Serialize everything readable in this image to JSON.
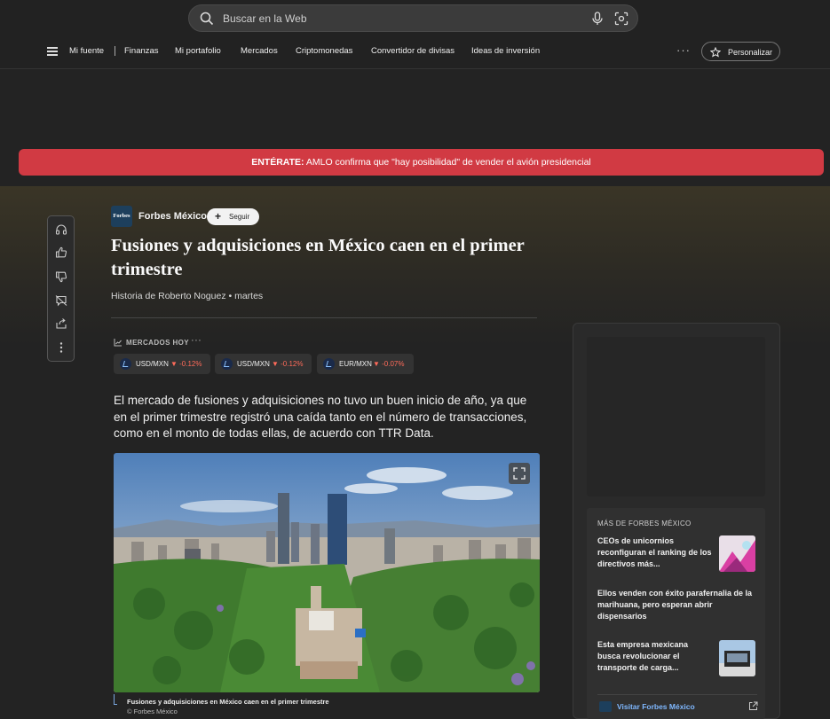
{
  "search": {
    "placeholder": "Buscar en la Web"
  },
  "nav": {
    "items": [
      "Mi fuente",
      "Finanzas",
      "Mi portafolio",
      "Mercados",
      "Criptomonedas",
      "Convertidor de divisas",
      "Ideas de inversión"
    ],
    "more": "···",
    "personalize": "Personalizar"
  },
  "alert": {
    "label": "ENTÉRATE:",
    "text": " AMLO confirma que \"hay posibilidad\" de vender el avión presidencial"
  },
  "article": {
    "source_logo": "Forbes",
    "source": "Forbes México",
    "follow": "Seguir",
    "title": "Fusiones y adquisiciones en México caen en el primer trimestre",
    "byline": "Historia de Roberto Noguez • martes",
    "lead": "El mercado de fusiones y adquisiciones no tuvo un buen inicio de año, ya que en el primer trimestre registró una caída tanto en el número de transacciones, como en el monto de todas ellas, de acuerdo con TTR Data.",
    "caption": "Fusiones y adquisiciones en México caen en el primer trimestre",
    "credit": "© Forbes México"
  },
  "markets": {
    "title": "MERCADOS HOY",
    "more": "···",
    "tickers": [
      {
        "pair": "USD/MXN",
        "change": "▼ -0.12%"
      },
      {
        "pair": "USD/MXN",
        "change": "▼ -0.12%"
      },
      {
        "pair": "EUR/MXN",
        "change": "▼ -0.07%"
      }
    ]
  },
  "sidebar": {
    "more_title": "MÁS DE FORBES MÉXICO",
    "stories": [
      "CEOs de unicornios reconfiguran el ranking de los directivos más...",
      "Ellos venden con éxito parafernalia de la marihuana, pero esperan abrir dispensarios",
      "Esta empresa mexicana busca revolucionar el transporte de carga..."
    ],
    "visit": "Visitar Forbes México"
  },
  "colors": {
    "alert": "#d13a43",
    "accent_link": "#7fb8ff",
    "down": "#ff6b5a"
  }
}
